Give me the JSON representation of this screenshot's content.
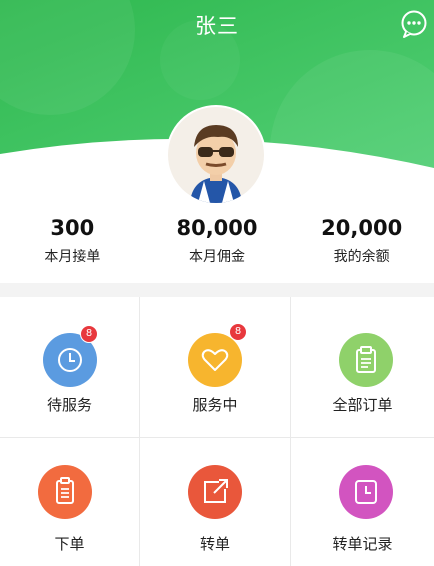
{
  "header": {
    "title": "张三",
    "chat_icon": "chat-bubble-icon",
    "bg_color": "#3fc05f"
  },
  "stats": [
    {
      "value": "300",
      "label": "本月接单"
    },
    {
      "value": "80,000",
      "label": "本月佣金"
    },
    {
      "value": "20,000",
      "label": "我的余额"
    }
  ],
  "menu": [
    {
      "label": "待服务",
      "icon": "clock-icon",
      "color": "#5b9be0",
      "badge": "8"
    },
    {
      "label": "服务中",
      "icon": "heart-icon",
      "color": "#f7b52e",
      "badge": "8"
    },
    {
      "label": "全部订单",
      "icon": "clipboard-icon",
      "color": "#8fd16a"
    },
    {
      "label": "下单",
      "icon": "document-icon",
      "color": "#f26b3f"
    },
    {
      "label": "转单",
      "icon": "share-icon",
      "color": "#e9573b"
    },
    {
      "label": "转单记录",
      "icon": "clock-icon",
      "color": "#d254c0"
    }
  ]
}
